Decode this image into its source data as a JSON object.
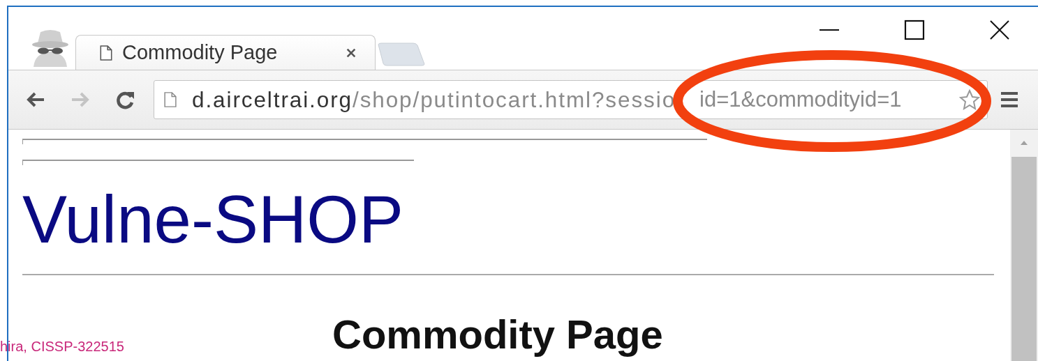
{
  "tabs": [
    {
      "title": "Commodity Page",
      "selected": true
    }
  ],
  "nav": {
    "back": {
      "disabled": false
    },
    "forward": {
      "disabled": true
    }
  },
  "address": {
    "host": "d.airceltrai.org",
    "path_parts": [
      "/shop/putintocart.html?sessio",
      "id=1&commodityid=1"
    ]
  },
  "page": {
    "site_title": "Vulne-SHOP",
    "heading": "Commodity Page"
  },
  "footer": {
    "credit": "hira, CISSP-322515"
  }
}
